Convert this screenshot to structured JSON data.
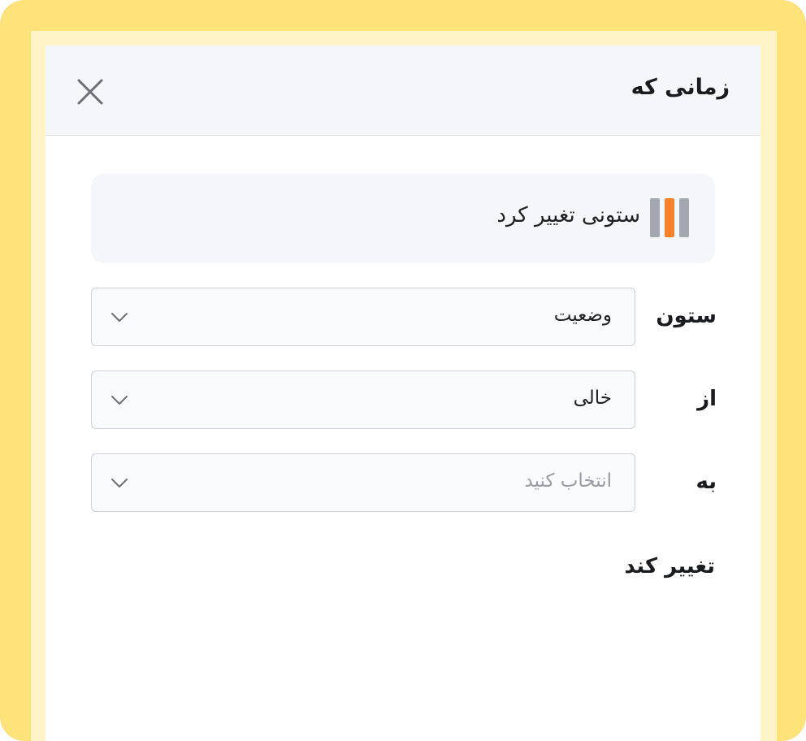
{
  "header": {
    "title": "زمانی که",
    "close_icon": "close-icon"
  },
  "trigger": {
    "label": "ستونی تغییر کرد",
    "icon": "columns-icon",
    "colors": {
      "bars": "#a3a7b0",
      "accent": "#f7822b"
    }
  },
  "fields": [
    {
      "label": "ستون",
      "value": "وضعیت",
      "is_placeholder": false
    },
    {
      "label": "از",
      "value": "خالی",
      "is_placeholder": false
    },
    {
      "label": "به",
      "value": "انتخاب کنید",
      "is_placeholder": true
    }
  ],
  "footer": {
    "text": "تغییر کند"
  }
}
